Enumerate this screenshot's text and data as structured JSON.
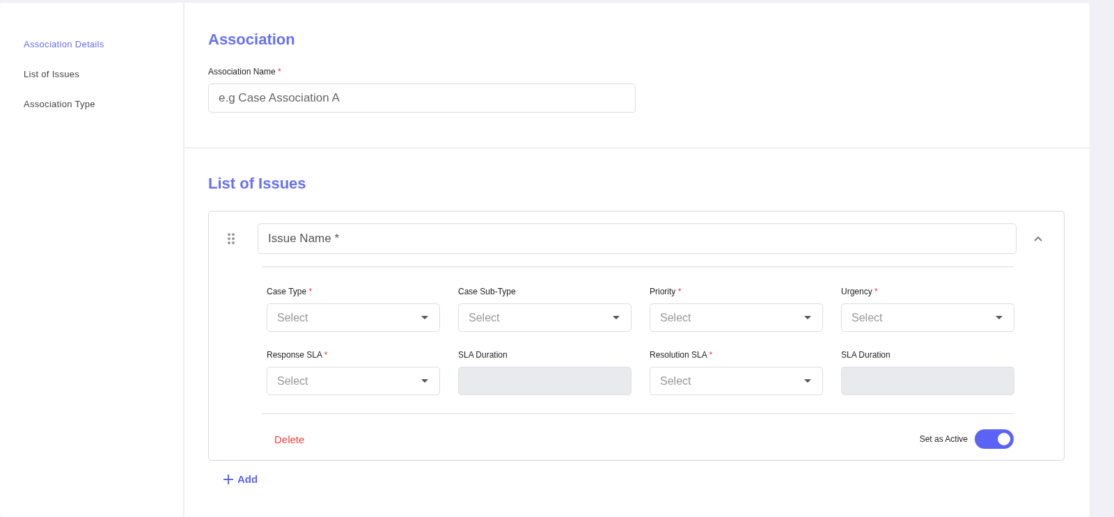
{
  "sidebar": {
    "items": [
      {
        "label": "Association Details",
        "selected": true
      },
      {
        "label": "List of Issues",
        "selected": false
      },
      {
        "label": "Association Type",
        "selected": false
      }
    ]
  },
  "association": {
    "title": "Association",
    "field": {
      "label": "Association Name",
      "required_mark": "*",
      "placeholder": "e.g Case Association A"
    }
  },
  "issues": {
    "title": "List of Issues",
    "items": [
      {
        "name_placeholder": "Issue Name *",
        "expanded": true,
        "fields": [
          {
            "kind": "select",
            "label": "Case Type",
            "required_mark": "*",
            "placeholder": "Select"
          },
          {
            "kind": "select",
            "label": "Case Sub-Type",
            "placeholder": "Select"
          },
          {
            "kind": "select",
            "label": "Priority",
            "required_mark": "*",
            "placeholder": "Select"
          },
          {
            "kind": "select",
            "label": "Urgency",
            "required_mark": "*",
            "placeholder": "Select"
          },
          {
            "kind": "select",
            "label": "Response SLA",
            "required_mark": "*",
            "placeholder": "Select"
          },
          {
            "kind": "readonly",
            "label": "SLA Duration"
          },
          {
            "kind": "select",
            "label": "Resolution SLA",
            "required_mark": "*",
            "placeholder": "Select"
          },
          {
            "kind": "readonly",
            "label": "SLA Duration"
          }
        ],
        "delete_label": "Delete",
        "active_label": "Set as Active",
        "active": true
      }
    ],
    "add_label": "Add"
  }
}
